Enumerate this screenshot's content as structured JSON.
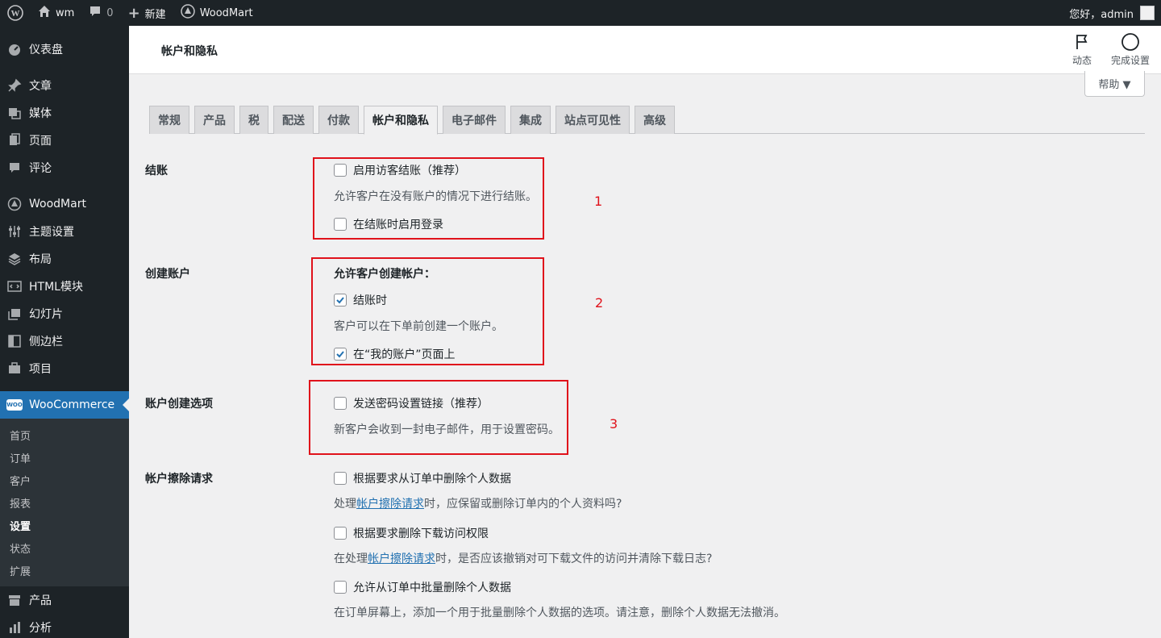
{
  "adminbar": {
    "site_name": "wm",
    "comments_count": "0",
    "new_label": "新建",
    "woodmart_label": "WoodMart",
    "greeting": "您好，admin"
  },
  "sidebar": {
    "items": [
      {
        "label": "仪表盘",
        "icon": "dashboard-icon"
      },
      {
        "label": "文章",
        "icon": "pin-icon"
      },
      {
        "label": "媒体",
        "icon": "media-icon"
      },
      {
        "label": "页面",
        "icon": "page-icon"
      },
      {
        "label": "评论",
        "icon": "comment-icon"
      },
      {
        "label": "WoodMart",
        "icon": "woodmart-icon"
      },
      {
        "label": "主题设置",
        "icon": "sliders-icon"
      },
      {
        "label": "布局",
        "icon": "layers-icon"
      },
      {
        "label": "HTML模块",
        "icon": "html-block-icon"
      },
      {
        "label": "幻灯片",
        "icon": "slides-icon"
      },
      {
        "label": "侧边栏",
        "icon": "sidebar-icon"
      },
      {
        "label": "项目",
        "icon": "briefcase-icon"
      },
      {
        "label": "WooCommerce",
        "icon": "woo-icon"
      },
      {
        "label": "产品",
        "icon": "archive-icon"
      },
      {
        "label": "分析",
        "icon": "chart-icon"
      }
    ],
    "woo_badge": "WOO",
    "submenu": [
      "首页",
      "订单",
      "客户",
      "报表",
      "设置",
      "状态",
      "扩展"
    ]
  },
  "header": {
    "title": "帐户和隐私",
    "activity_label": "动态",
    "setup_label": "完成设置",
    "help_label": "帮助 ▼"
  },
  "tabs": [
    "常规",
    "产品",
    "税",
    "配送",
    "付款",
    "帐户和隐私",
    "电子邮件",
    "集成",
    "站点可见性",
    "高级"
  ],
  "form": {
    "checkout": {
      "label": "结账",
      "guest_checkout": {
        "label": "启用访客结账（推荐）",
        "checked": false
      },
      "guest_desc": "允许客户在没有账户的情况下进行结账。",
      "login_at_checkout": {
        "label": "在结账时启用登录",
        "checked": false
      }
    },
    "account_creation": {
      "label": "创建账户",
      "heading": "允许客户创建帐户：",
      "at_checkout": {
        "label": "结账时",
        "checked": true
      },
      "at_checkout_desc": "客户可以在下单前创建一个账户。",
      "my_account": {
        "label": "在“我的账户”页面上",
        "checked": true
      }
    },
    "account_options": {
      "label": "账户创建选项",
      "send_password_link": {
        "label": "发送密码设置链接（推荐）",
        "checked": false
      },
      "send_password_desc": "新客户会收到一封电子邮件，用于设置密码。"
    },
    "erasure": {
      "label": "帐户擦除请求",
      "remove_order_data": {
        "label": "根据要求从订单中删除个人数据",
        "checked": false
      },
      "desc1_prefix": "处理",
      "desc1_link": "帐户擦除请求",
      "desc1_suffix": "时，应保留或删除订单内的个人资料吗?",
      "remove_download_access": {
        "label": "根据要求删除下载访问权限",
        "checked": false
      },
      "desc2_prefix": "在处理",
      "desc2_link": "帐户擦除请求",
      "desc2_suffix": "时，是否应该撤销对可下载文件的访问并清除下载日志?",
      "bulk_remove": {
        "label": "允许从订单中批量删除个人数据",
        "checked": false
      },
      "desc3": "在订单屏幕上，添加一个用于批量删除个人数据的选项。请注意，删除个人数据无法撤消。"
    }
  },
  "annotations": [
    "1",
    "2",
    "3"
  ],
  "colors": {
    "annotation_red": "#e0121b",
    "admin_blue": "#2271b1",
    "sidebar_bg": "#1d2327"
  }
}
